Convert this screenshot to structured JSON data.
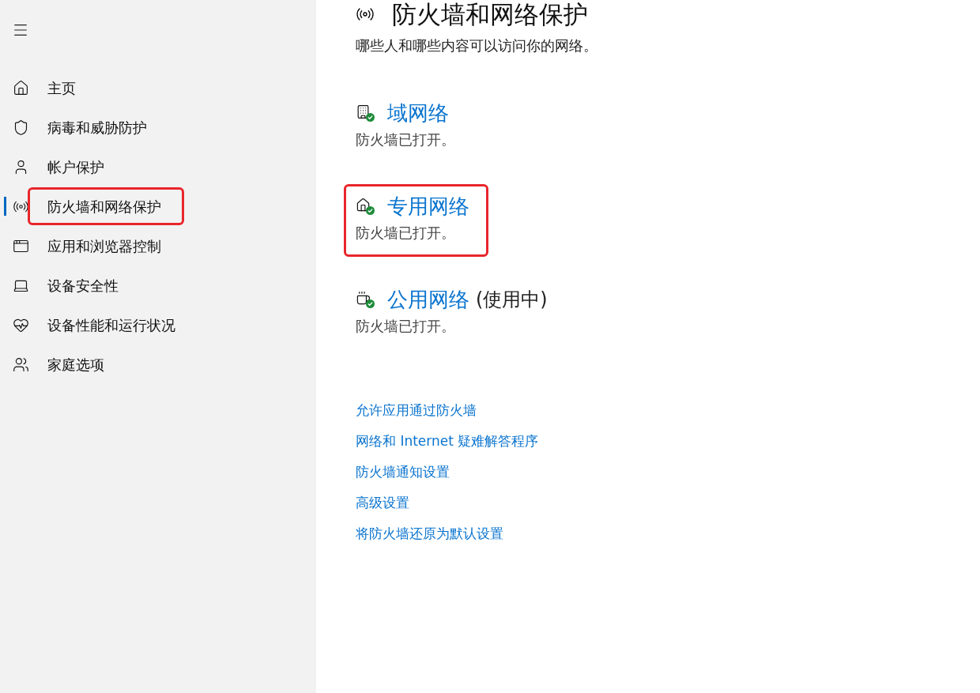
{
  "sidebar": {
    "items": [
      {
        "label": "主页",
        "selected": false,
        "highlighted": false
      },
      {
        "label": "病毒和威胁防护",
        "selected": false,
        "highlighted": false
      },
      {
        "label": "帐户保护",
        "selected": false,
        "highlighted": false
      },
      {
        "label": "防火墙和网络保护",
        "selected": true,
        "highlighted": true
      },
      {
        "label": "应用和浏览器控制",
        "selected": false,
        "highlighted": false
      },
      {
        "label": "设备安全性",
        "selected": false,
        "highlighted": false
      },
      {
        "label": "设备性能和运行状况",
        "selected": false,
        "highlighted": false
      },
      {
        "label": "家庭选项",
        "selected": false,
        "highlighted": false
      }
    ]
  },
  "page": {
    "title": "防火墙和网络保护",
    "subtitle": "哪些人和哪些内容可以访问你的网络。",
    "networks": [
      {
        "name": "域网络",
        "status": "防火墙已打开。",
        "highlighted": false
      },
      {
        "name": "专用网络",
        "status": "防火墙已打开。",
        "highlighted": true
      },
      {
        "name": "公用网络",
        "suffix": "(使用中)",
        "status": "防火墙已打开。",
        "highlighted": false
      }
    ],
    "links": [
      "允许应用通过防火墙",
      "网络和 Internet 疑难解答程序",
      "防火墙通知设置",
      "高级设置",
      "将防火墙还原为默认设置"
    ]
  }
}
